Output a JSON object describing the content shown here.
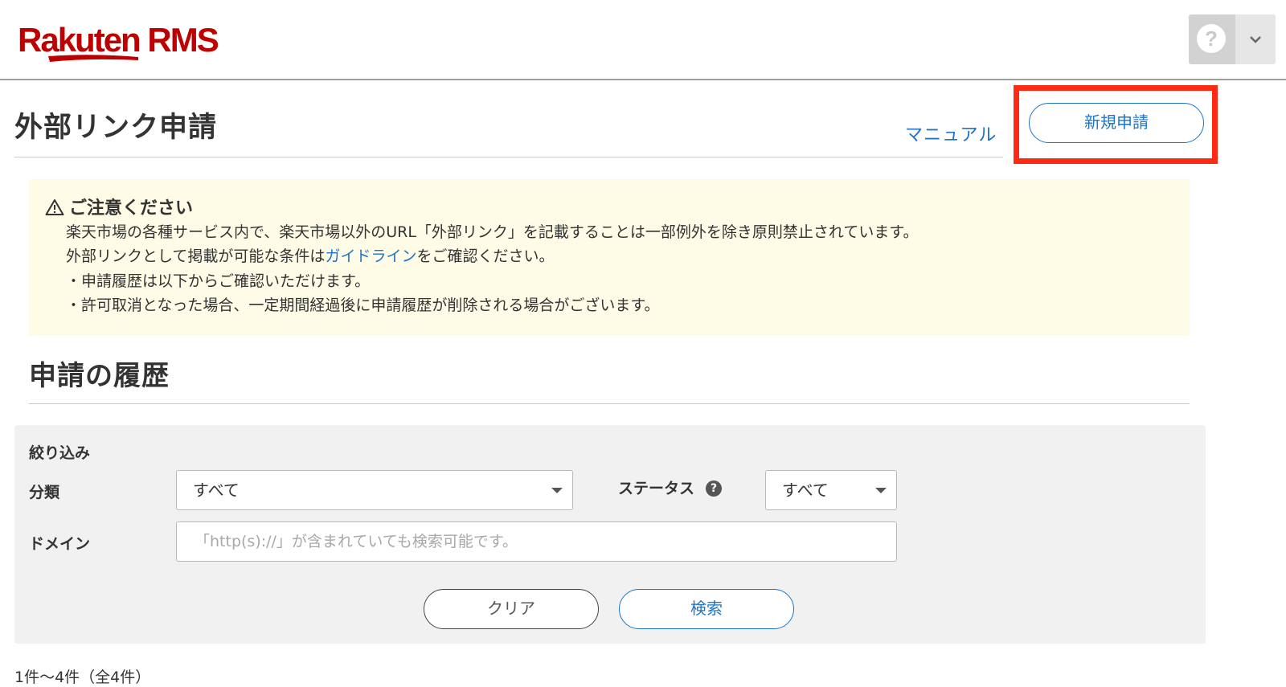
{
  "header": {
    "logo": "Rakuten RMS",
    "help_icon": "question-mark-icon",
    "menu_icon": "chevron-down-icon"
  },
  "page": {
    "title": "外部リンク申請",
    "manual_link": "マニュアル",
    "new_request_button": "新規申請",
    "highlight_color": "#ff2a14"
  },
  "notice": {
    "icon": "warning-triangle-icon",
    "title": "ご注意ください",
    "line1": "楽天市場の各種サービス内で、楽天市場以外のURL「外部リンク」を記載することは一部例外を除き原則禁止されています。",
    "line2_before": "外部リンクとして掲載が可能な条件は",
    "line2_link": "ガイドライン",
    "line2_after": "をご確認ください。",
    "bullet1": "・申請履歴は以下からご確認いただけます。",
    "bullet2": "・許可取消となった場合、一定期間経過後に申請履歴が削除される場合がございます。"
  },
  "history": {
    "title": "申請の履歴"
  },
  "filter": {
    "heading": "絞り込み",
    "category_label": "分類",
    "category_value": "すべて",
    "status_label": "ステータス",
    "status_help_icon": "question-circle-icon",
    "status_value": "すべて",
    "domain_label": "ドメイン",
    "domain_placeholder": "「http(s)://」が含まれていても検索可能です。",
    "domain_value": "",
    "clear_button": "クリア",
    "search_button": "検索"
  },
  "results": {
    "count_text": "1件〜4件（全4件）"
  },
  "colors": {
    "brand": "#bf0000",
    "link": "#1d74c8",
    "notice_bg": "#fefce6",
    "panel_bg": "#f1f1f1"
  }
}
